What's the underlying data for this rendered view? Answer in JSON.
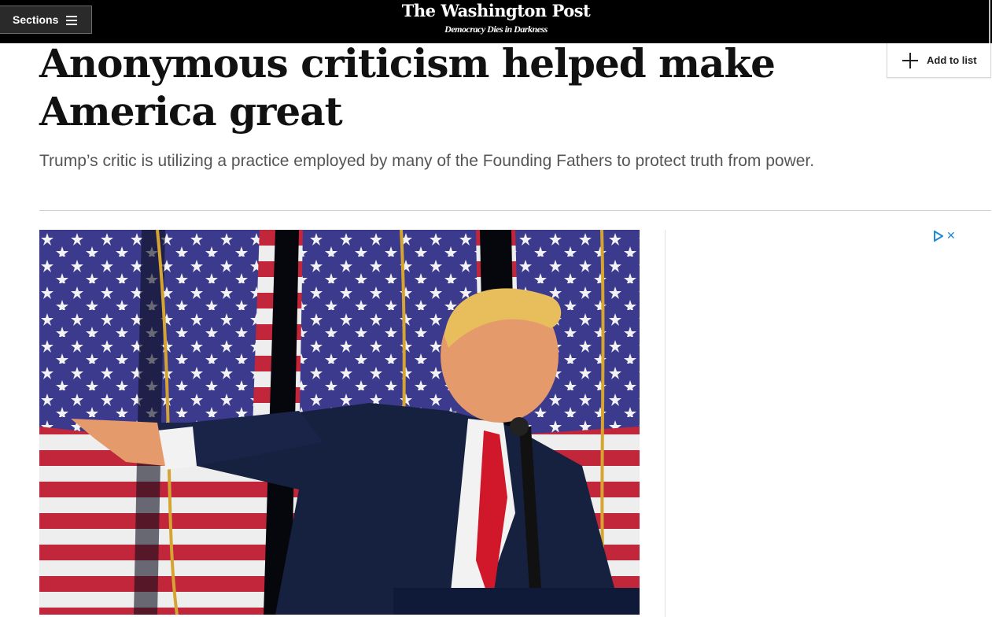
{
  "header": {
    "sections_label": "Sections",
    "logo_text": "The Washington Post",
    "tagline": "Democracy Dies in Darkness"
  },
  "article": {
    "add_to_list_label": "Add to list",
    "headline": "Anonymous criticism helped make America great",
    "subheadline": "Trump’s critic is utilizing a practice employed by many of the Founding Fathers to protect truth from power."
  },
  "ad": {
    "adchoices_icon": "adchoices-play-icon",
    "close_icon": "close-icon",
    "accent_color": "#1f8bd6"
  },
  "colors": {
    "header_bg": "#000000",
    "headline": "#111111",
    "subheadline": "#555555"
  },
  "icons": {
    "sections": "hamburger-icon",
    "add_to_list": "plus-icon"
  }
}
